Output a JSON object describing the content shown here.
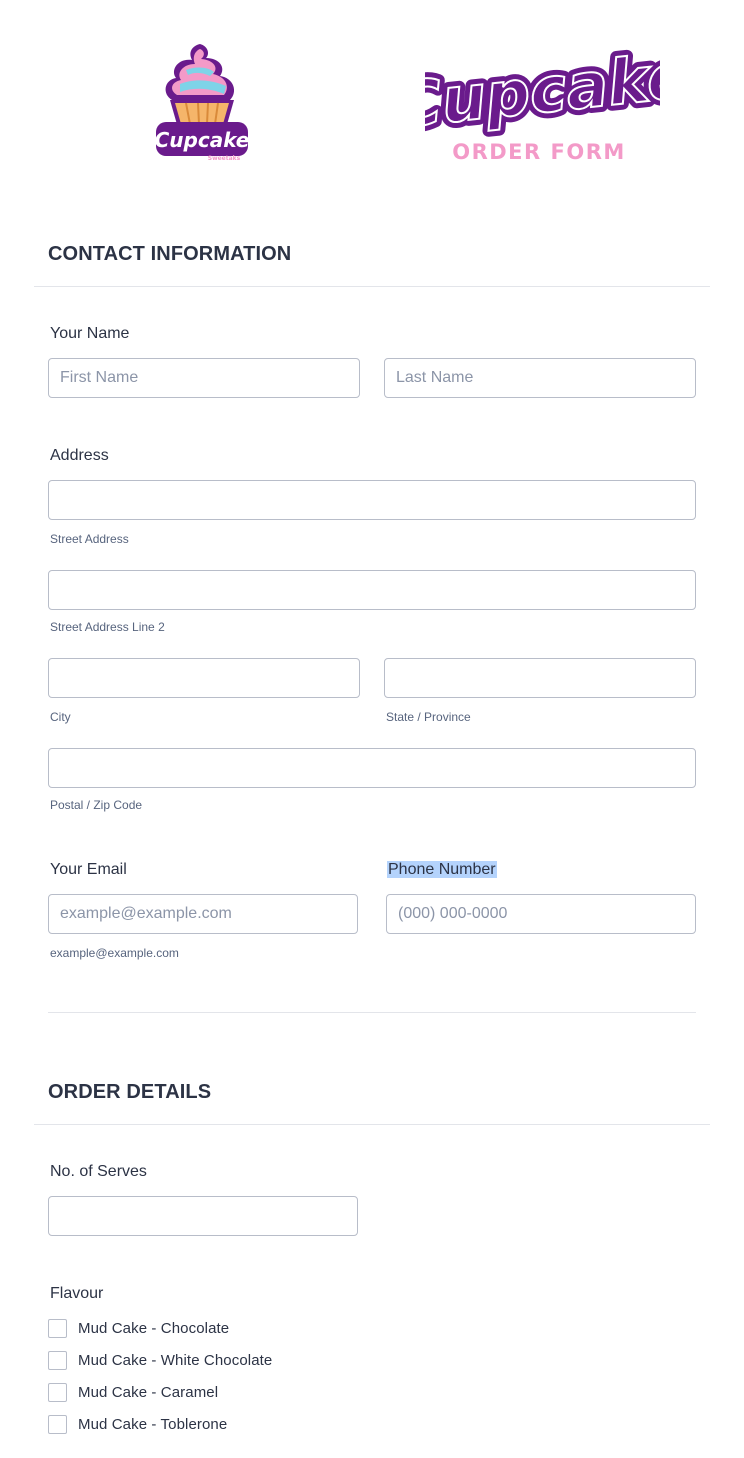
{
  "header": {
    "logo_left": {
      "word": "Cupcake",
      "tagline": "Sweetaks"
    },
    "logo_right": {
      "word": "Cupcake",
      "subtitle": "ORDER FORM"
    }
  },
  "contact": {
    "title": "CONTACT INFORMATION",
    "name": {
      "label": "Your Name",
      "first_placeholder": "First Name",
      "last_placeholder": "Last Name"
    },
    "address": {
      "label": "Address",
      "street_sublabel": "Street Address",
      "street2_sublabel": "Street Address Line 2",
      "city_sublabel": "City",
      "state_sublabel": "State / Province",
      "postal_sublabel": "Postal / Zip Code"
    },
    "email": {
      "label": "Your Email",
      "placeholder": "example@example.com",
      "sublabel": "example@example.com"
    },
    "phone": {
      "label": "Phone Number",
      "placeholder": "(000) 000-0000"
    }
  },
  "order": {
    "title": "ORDER DETAILS",
    "serves_label": "No. of Serves",
    "flavour_label": "Flavour",
    "flavours": [
      "Mud Cake - Chocolate",
      "Mud Cake - White Chocolate",
      "Mud Cake - Caramel",
      "Mud Cake - Toblerone"
    ]
  },
  "colors": {
    "accent_purple": "#6a1b8c",
    "accent_pink": "#f39ac8",
    "text": "#2c3345",
    "border": "#b8bdc9",
    "selection": "#b4d3fc"
  }
}
